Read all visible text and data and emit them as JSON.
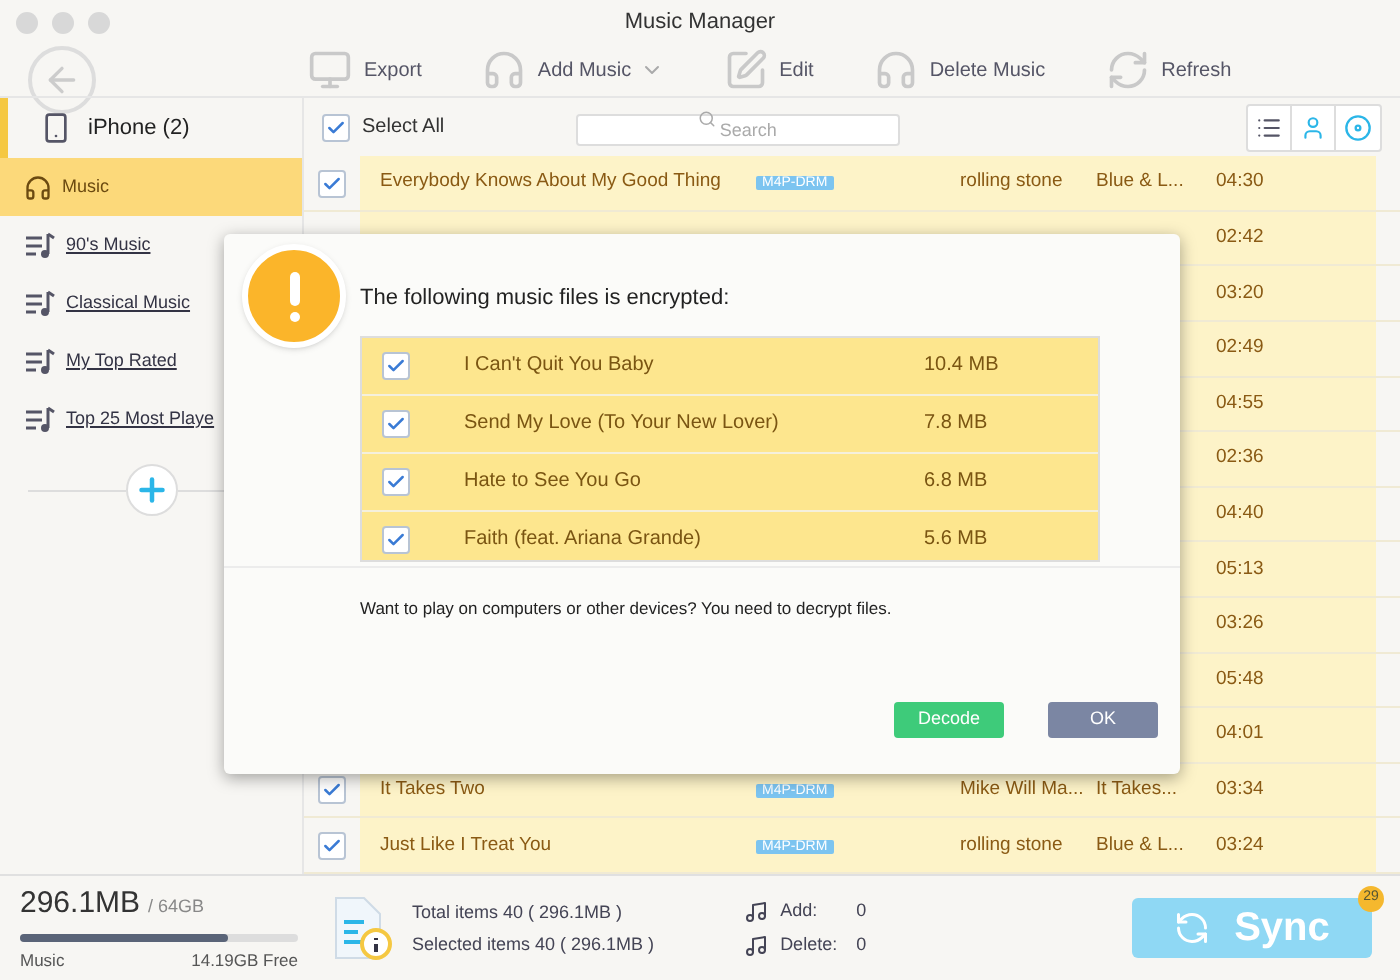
{
  "window": {
    "title": "Music Manager"
  },
  "toolbar": [
    {
      "kind": "export",
      "label": "Export"
    },
    {
      "kind": "add",
      "label": "Add Music",
      "dropdown": true
    },
    {
      "kind": "edit",
      "label": "Edit"
    },
    {
      "kind": "delete",
      "label": "Delete Music"
    },
    {
      "kind": "refresh",
      "label": "Refresh"
    }
  ],
  "device": {
    "label": "iPhone (2)"
  },
  "sidebar": {
    "items": [
      {
        "kind": "library",
        "label": "Music",
        "selected": true
      },
      {
        "kind": "playlist",
        "label": "90's Music",
        "selected": false
      },
      {
        "kind": "playlist",
        "label": "Classical Music",
        "selected": false
      },
      {
        "kind": "playlist",
        "label": "My Top Rated",
        "selected": false
      },
      {
        "kind": "playlist",
        "label": "Top 25 Most Playe",
        "selected": false
      }
    ]
  },
  "select_all": {
    "label": "Select All",
    "checked": true
  },
  "search": {
    "placeholder": "Search"
  },
  "rows": [
    {
      "checked": true,
      "title": "Everybody Knows About My Good Thing",
      "tag": "M4P-DRM",
      "artist": "rolling stone",
      "album": "Blue & L...",
      "duration": "04:30"
    },
    {
      "duration": "02:42"
    },
    {
      "duration": "03:20"
    },
    {
      "duration": "02:49"
    },
    {
      "duration": "04:55"
    },
    {
      "duration": "02:36"
    },
    {
      "duration": "04:40"
    },
    {
      "duration": "05:13"
    },
    {
      "duration": "03:26"
    },
    {
      "duration": "05:48"
    },
    {
      "duration": "04:01"
    },
    {
      "checked": true,
      "title": "It Takes Two",
      "tag": "M4P-DRM",
      "artist": "Mike Will Ma...",
      "album": "It Takes...",
      "duration": "03:34"
    },
    {
      "checked": true,
      "title": "Just Like I Treat You",
      "tag": "M4P-DRM",
      "artist": "rolling stone",
      "album": "Blue & L...",
      "duration": "03:24"
    }
  ],
  "dialog": {
    "message": "The following music files is encrypted:",
    "files": [
      {
        "checked": true,
        "name": "I Can't Quit You Baby",
        "size": "10.4 MB"
      },
      {
        "checked": true,
        "name": "Send My Love (To Your New Lover)",
        "size": "7.8 MB"
      },
      {
        "checked": true,
        "name": "Hate to See You Go",
        "size": "6.8 MB"
      },
      {
        "checked": true,
        "name": "Faith (feat. Ariana Grande)",
        "size": "5.6 MB"
      }
    ],
    "note": "Want to play on computers or other devices? You need to decrypt files.",
    "buttons": [
      {
        "kind": "primary",
        "label": "Decode"
      },
      {
        "kind": "secondary",
        "label": "OK"
      }
    ]
  },
  "footer": {
    "used": "296.1MB",
    "capacity": "/ 64GB",
    "level": 0.75,
    "category": "Music",
    "free": "14.19GB Free",
    "total": "Total items 40 ( 296.1MB )",
    "selected": "Selected items 40 ( 296.1MB )",
    "add_label": "Add:",
    "add_value": "0",
    "delete_label": "Delete:",
    "delete_value": "0",
    "sync": "Sync",
    "badge": "29"
  }
}
